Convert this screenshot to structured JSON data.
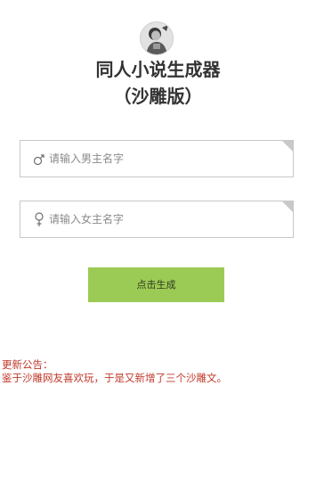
{
  "header": {
    "avatar_icon": "avatar-photo",
    "title": "同人小说生成器",
    "subtitle": "（沙雕版）"
  },
  "form": {
    "male_name": {
      "icon": "male-symbol-icon",
      "placeholder": "请输入男主名字",
      "value": ""
    },
    "female_name": {
      "icon": "female-symbol-icon",
      "placeholder": "请输入女主名字",
      "value": ""
    },
    "generate_label": "点击生成"
  },
  "notice": {
    "title": "更新公告：",
    "body": "鉴于沙雕网友喜欢玩，于是又新增了三个沙雕文。"
  },
  "colors": {
    "button": "#9ccb55",
    "notice_text": "#c0392b",
    "field_border": "#c8c8c8"
  }
}
